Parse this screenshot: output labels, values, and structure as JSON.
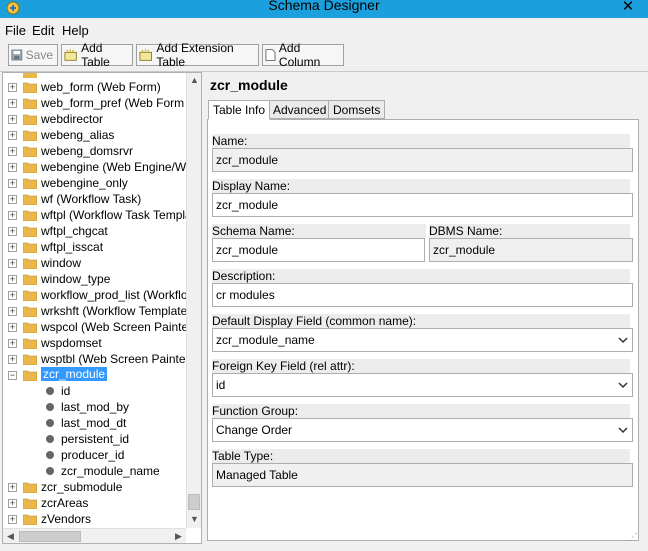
{
  "window": {
    "title": "Schema Designer",
    "close_glyph": "✕"
  },
  "menu": {
    "file": "File",
    "edit": "Edit",
    "help": "Help"
  },
  "toolbar": {
    "save": "Save",
    "add_table": "Add Table",
    "add_extension_table": "Add Extension Table",
    "add_column": "Add Column"
  },
  "tree": {
    "nodes": [
      {
        "label": "web_form (Web Form)",
        "expander": "+"
      },
      {
        "label": "web_form_pref (Web Form Pr",
        "expander": "+"
      },
      {
        "label": "webdirector",
        "expander": "+"
      },
      {
        "label": "webeng_alias",
        "expander": "+"
      },
      {
        "label": "webeng_domsrvr",
        "expander": "+"
      },
      {
        "label": "webengine (Web Engine/Web",
        "expander": "+"
      },
      {
        "label": "webengine_only",
        "expander": "+"
      },
      {
        "label": "wf (Workflow Task)",
        "expander": "+"
      },
      {
        "label": "wftpl (Workflow Task Templat",
        "expander": "+"
      },
      {
        "label": "wftpl_chgcat",
        "expander": "+"
      },
      {
        "label": "wftpl_isscat",
        "expander": "+"
      },
      {
        "label": "window",
        "expander": "+"
      },
      {
        "label": "window_type",
        "expander": "+"
      },
      {
        "label": "workflow_prod_list (Workflow",
        "expander": "+"
      },
      {
        "label": "wrkshft (Workflow Template V",
        "expander": "+"
      },
      {
        "label": "wspcol (Web Screen Painter C",
        "expander": "+"
      },
      {
        "label": "wspdomset",
        "expander": "+"
      },
      {
        "label": "wsptbl (Web Screen Painter T",
        "expander": "+"
      },
      {
        "label": "zcr_module",
        "expander": "−",
        "selected": true
      }
    ],
    "children": [
      "id",
      "last_mod_by",
      "last_mod_dt",
      "persistent_id",
      "producer_id",
      "zcr_module_name"
    ],
    "after": [
      {
        "label": "zcr_submodule",
        "expander": "+"
      },
      {
        "label": "zcrAreas",
        "expander": "+"
      },
      {
        "label": "zVendors",
        "expander": "+"
      }
    ]
  },
  "panel": {
    "title": "zcr_module",
    "tabs": [
      "Table Info",
      "Advanced",
      "Domsets"
    ],
    "fields": {
      "name_label": "Name:",
      "name_value": "zcr_module",
      "display_label": "Display Name:",
      "display_value": "zcr_module",
      "schema_label": "Schema Name:",
      "schema_value": "zcr_module",
      "dbms_label": "DBMS Name:",
      "dbms_value": "zcr_module",
      "desc_label": "Description:",
      "desc_value": "cr modules",
      "default_label": "Default Display Field (common name):",
      "default_value": "zcr_module_name",
      "fk_label": "Foreign Key Field (rel attr):",
      "fk_value": "id",
      "fg_label": "Function Group:",
      "fg_value": "Change Order",
      "type_label": "Table Type:",
      "type_value": "Managed Table"
    }
  },
  "colors": {
    "titlebar": "#1ba0dd",
    "selection": "#3399ff",
    "folder": "#e8b84a"
  }
}
